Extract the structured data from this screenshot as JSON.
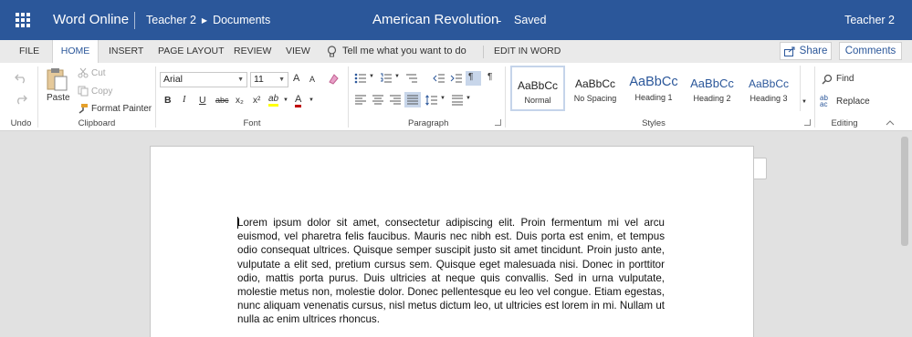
{
  "app": {
    "name": "Word Online",
    "breadcrumb": [
      "Teacher 2",
      "Documents"
    ],
    "doc_title": "American Revolution",
    "separator": "-",
    "save_status": "Saved",
    "user": "Teacher 2"
  },
  "tabs": [
    {
      "label": "FILE"
    },
    {
      "label": "HOME"
    },
    {
      "label": "INSERT"
    },
    {
      "label": "PAGE LAYOUT"
    },
    {
      "label": "REVIEW"
    },
    {
      "label": "VIEW"
    }
  ],
  "tellme": "Tell me what you want to do",
  "edit_in_word": "EDIT IN WORD",
  "share_label": "Share",
  "comments_label": "Comments",
  "ribbon": {
    "undo_group": "Undo",
    "clipboard": {
      "paste": "Paste",
      "cut": "Cut",
      "copy": "Copy",
      "format_painter": "Format Painter",
      "group": "Clipboard"
    },
    "font": {
      "name": "Arial",
      "size": "11",
      "group": "Font",
      "bold": "B",
      "italic": "I",
      "underline": "U",
      "strike": "abc",
      "sub": "x₂",
      "sup": "x²",
      "grow": "A",
      "shrink": "A",
      "color": "A",
      "highlight": "ab"
    },
    "paragraph_group": "Paragraph",
    "styles": [
      {
        "sample": "AaBbCc",
        "name": "Normal"
      },
      {
        "sample": "AaBbCc",
        "name": "No Spacing"
      },
      {
        "sample": "AaBbCc",
        "name": "Heading 1"
      },
      {
        "sample": "AaBbCc",
        "name": "Heading 2"
      },
      {
        "sample": "AaBbCc",
        "name": "Heading 3"
      }
    ],
    "styles_group": "Styles",
    "editing": {
      "find": "Find",
      "replace": "Replace",
      "group": "Editing"
    }
  },
  "document": {
    "text": "Lorem ipsum dolor sit amet, consectetur adipiscing elit. Proin fermentum mi vel arcu euismod, vel pharetra felis faucibus. Mauris nec nibh est. Duis porta est enim, et tempus odio consequat ultrices. Quisque semper suscipit justo sit amet tincidunt. Proin justo ante, vulputate a elit sed, pretium cursus sem. Quisque eget malesuada nisi. Donec in porttitor odio, mattis porta purus. Duis ultricies at neque quis convallis. Sed in urna vulputate, molestie metus non, molestie dolor. Donec pellentesque eu leo vel congue. Etiam egestas, nunc aliquam venenatis cursus, nisl metus dictum leo, ut ultricies est lorem in mi. Nullam ut nulla ac enim ultrices rhoncus."
  },
  "colors": {
    "brand": "#2b579a",
    "accent_font_color": "#c00000",
    "highlight": "#ffff00"
  }
}
